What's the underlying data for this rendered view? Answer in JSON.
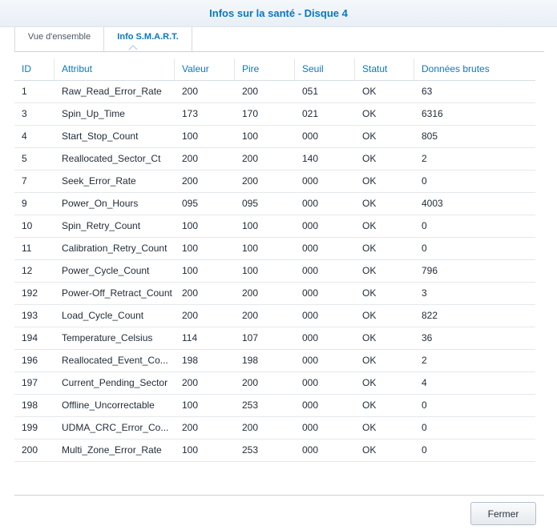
{
  "window": {
    "title": "Infos sur la santé - Disque 4"
  },
  "tabs": [
    {
      "label": "Vue d'ensemble",
      "active": false
    },
    {
      "label": "Info S.M.A.R.T.",
      "active": true
    }
  ],
  "colors": {
    "accent": "#0a78c2",
    "row_divider": "#e5e9ec"
  },
  "table": {
    "columns": [
      "ID",
      "Attribut",
      "Valeur",
      "Pire",
      "Seuil",
      "Statut",
      "Données brutes"
    ],
    "rows": [
      [
        "1",
        "Raw_Read_Error_Rate",
        "200",
        "200",
        "051",
        "OK",
        "63"
      ],
      [
        "3",
        "Spin_Up_Time",
        "173",
        "170",
        "021",
        "OK",
        "6316"
      ],
      [
        "4",
        "Start_Stop_Count",
        "100",
        "100",
        "000",
        "OK",
        "805"
      ],
      [
        "5",
        "Reallocated_Sector_Ct",
        "200",
        "200",
        "140",
        "OK",
        "2"
      ],
      [
        "7",
        "Seek_Error_Rate",
        "200",
        "200",
        "000",
        "OK",
        "0"
      ],
      [
        "9",
        "Power_On_Hours",
        "095",
        "095",
        "000",
        "OK",
        "4003"
      ],
      [
        "10",
        "Spin_Retry_Count",
        "100",
        "100",
        "000",
        "OK",
        "0"
      ],
      [
        "11",
        "Calibration_Retry_Count",
        "100",
        "100",
        "000",
        "OK",
        "0"
      ],
      [
        "12",
        "Power_Cycle_Count",
        "100",
        "100",
        "000",
        "OK",
        "796"
      ],
      [
        "192",
        "Power-Off_Retract_Count",
        "200",
        "200",
        "000",
        "OK",
        "3"
      ],
      [
        "193",
        "Load_Cycle_Count",
        "200",
        "200",
        "000",
        "OK",
        "822"
      ],
      [
        "194",
        "Temperature_Celsius",
        "114",
        "107",
        "000",
        "OK",
        "36"
      ],
      [
        "196",
        "Reallocated_Event_Co...",
        "198",
        "198",
        "000",
        "OK",
        "2"
      ],
      [
        "197",
        "Current_Pending_Sector",
        "200",
        "200",
        "000",
        "OK",
        "4"
      ],
      [
        "198",
        "Offline_Uncorrectable",
        "100",
        "253",
        "000",
        "OK",
        "0"
      ],
      [
        "199",
        "UDMA_CRC_Error_Co...",
        "200",
        "200",
        "000",
        "OK",
        "0"
      ],
      [
        "200",
        "Multi_Zone_Error_Rate",
        "100",
        "253",
        "000",
        "OK",
        "0"
      ]
    ]
  },
  "footer": {
    "close_label": "Fermer"
  }
}
